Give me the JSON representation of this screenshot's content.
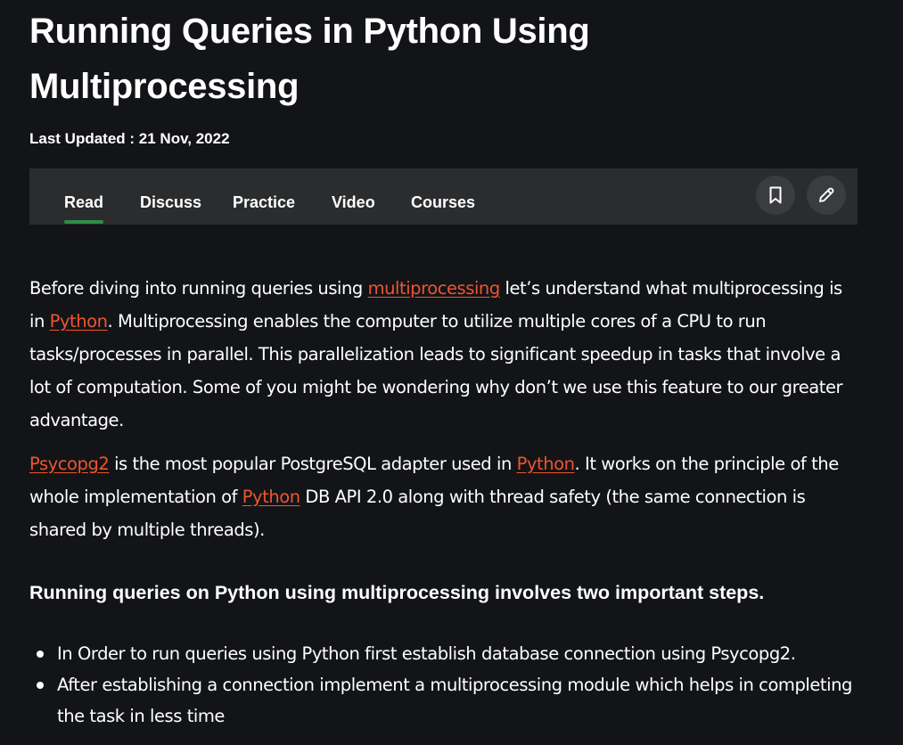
{
  "article": {
    "title": "Running Queries in Python Using Multiprocessing",
    "last_updated": "Last Updated : 21 Nov, 2022"
  },
  "tabs": [
    {
      "label": "Read",
      "active": true
    },
    {
      "label": "Discuss",
      "active": false
    },
    {
      "label": "Practice",
      "active": false
    },
    {
      "label": "Video",
      "active": false
    },
    {
      "label": "Courses",
      "active": false
    }
  ],
  "actions": {
    "bookmark_icon": "bookmark-icon",
    "edit_icon": "pencil-icon"
  },
  "paragraph1": {
    "t1": "Before diving into running queries using ",
    "link1": "multiprocessing",
    "t2": " let’s understand what multiprocessing is in ",
    "link2": "Python",
    "t3": ". Multiprocessing enables the computer to utilize multiple cores of a CPU to run tasks/processes in parallel. This parallelization leads to significant speedup in tasks that involve a lot of computation. Some of you might be wondering why don’t we use this feature to our greater advantage."
  },
  "paragraph2": {
    "link1": "Psycopg2",
    "t1": " is the most popular PostgreSQL adapter used in  ",
    "link2": "Python",
    "t2": ".  It works on the principle of the whole implementation of ",
    "link3": "Python",
    "t3": " DB API 2.0 along with thread safety (the same connection is shared by multiple threads)."
  },
  "section_heading": "Running queries on Python using multiprocessing involves two important steps.",
  "steps": [
    "In Order to run queries using Python first establish database connection using Psycopg2.",
    "After establishing a connection implement a multiprocessing module which helps in completing the task in less time"
  ],
  "colors": {
    "background": "#131417",
    "tab_bar": "#2b2c2e",
    "link": "#ee5530",
    "active_tab_underline": "#2f8d46"
  }
}
